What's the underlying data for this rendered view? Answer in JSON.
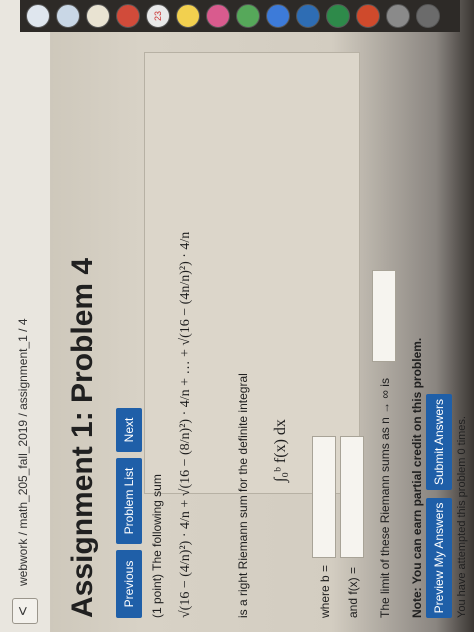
{
  "breadcrumb": "webwork / math_205_fall_2019 / assignment_1 / 4",
  "back_label": "<",
  "title": "Assignment 1: Problem 4",
  "nav": {
    "previous": "Previous",
    "problem_list": "Problem List",
    "next": "Next"
  },
  "problem": {
    "intro": "(1 point) The following sum",
    "sum_expression": "√(16 − (4/n)²) · 4/n + √(16 − (8/n)²) · 4/n + … + √(16 − (4n/n)²) · 4/n",
    "riemann_text": "is a right Riemann sum for the definite integral",
    "integral": "∫₀ᵇ f(x) dx",
    "where_b_label": "where b =",
    "and_f_label": "and f(x) =",
    "limit_text": "The limit of these Riemann sums as n → ∞ is"
  },
  "inputs": {
    "b_value": "",
    "f_value": "",
    "limit_value": ""
  },
  "note": "Note: You can earn partial credit on this problem.",
  "buttons": {
    "preview": "Preview My Answers",
    "submit": "Submit Answers"
  },
  "attempts_text": "You have attempted this problem 0 times.",
  "dock_badge": "23",
  "colors": {
    "button_blue": "#1f5fa8",
    "page_bg": "#d8d2c6"
  }
}
